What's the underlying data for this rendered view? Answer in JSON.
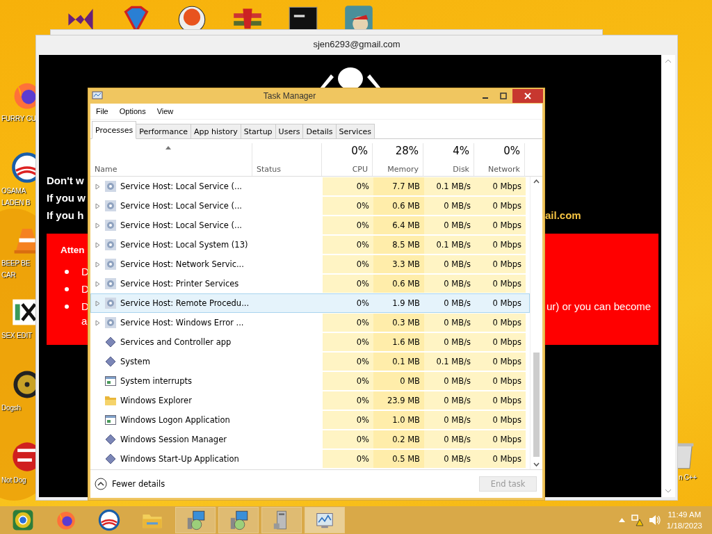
{
  "desktop": {
    "top_icons": [
      {
        "kind": "bowtie"
      },
      {
        "kind": "diamond"
      },
      {
        "kind": "ball"
      },
      {
        "kind": "emblem"
      },
      {
        "kind": "terminal"
      },
      {
        "kind": "globe"
      }
    ],
    "left_icons": [
      {
        "kind": "fox",
        "label": [
          "FURRY CU"
        ]
      },
      {
        "kind": "sunrise",
        "label": [
          "OSAMA",
          "LADEN B"
        ]
      },
      {
        "kind": "cone",
        "label": [
          "BEEP BE",
          "CAR"
        ]
      },
      {
        "kind": "hex",
        "label": [
          "SEX EDIT"
        ]
      },
      {
        "kind": "disc",
        "label": [
          "Dogsh"
        ]
      },
      {
        "kind": "dev",
        "label": [
          "Not Dog"
        ]
      }
    ],
    "right_icon": {
      "kind": "bin",
      "label": "n C++"
    }
  },
  "back_window": {
    "title": "sjen6293@gmail.com",
    "lines": [
      {
        "left": "Don't w"
      },
      {
        "left": "If you w"
      },
      {
        "left": "If you h",
        "right": "ail.com"
      }
    ],
    "notice": {
      "heading": "Atten",
      "bullets": [
        {
          "text": "D"
        },
        {
          "text": "D"
        },
        {
          "text": "D",
          "right": "ur) or you can become",
          "continuation": "a"
        }
      ]
    }
  },
  "task_manager": {
    "title": "Task Manager",
    "menu": [
      "File",
      "Options",
      "View"
    ],
    "tabs": [
      {
        "label": "Processes",
        "selected": true
      },
      {
        "label": "Performance",
        "selected": false
      },
      {
        "label": "App history",
        "selected": false
      },
      {
        "label": "Startup",
        "selected": false
      },
      {
        "label": "Users",
        "selected": false
      },
      {
        "label": "Details",
        "selected": false
      },
      {
        "label": "Services",
        "selected": false
      }
    ],
    "columns": [
      {
        "label": "Name"
      },
      {
        "label": "Status"
      },
      {
        "label": "CPU",
        "percent": "0%"
      },
      {
        "label": "Memory",
        "percent": "28%"
      },
      {
        "label": "Disk",
        "percent": "4%"
      },
      {
        "label": "Network",
        "percent": "0%"
      }
    ],
    "rows": [
      {
        "kind": "group",
        "name": "Service Host: Local Service (...",
        "cpu": "0%",
        "memory": "7.7 MB",
        "disk": "0.1 MB/s",
        "network": "0 Mbps",
        "selected": false
      },
      {
        "kind": "group",
        "name": "Service Host: Local Service (...",
        "cpu": "0%",
        "memory": "0.6 MB",
        "disk": "0 MB/s",
        "network": "0 Mbps",
        "selected": false
      },
      {
        "kind": "group",
        "name": "Service Host: Local Service (...",
        "cpu": "0%",
        "memory": "6.4 MB",
        "disk": "0 MB/s",
        "network": "0 Mbps",
        "selected": false
      },
      {
        "kind": "group",
        "name": "Service Host: Local System (13)",
        "cpu": "0%",
        "memory": "8.5 MB",
        "disk": "0.1 MB/s",
        "network": "0 Mbps",
        "selected": false
      },
      {
        "kind": "group",
        "name": "Service Host: Network Servic...",
        "cpu": "0%",
        "memory": "3.3 MB",
        "disk": "0 MB/s",
        "network": "0 Mbps",
        "selected": false
      },
      {
        "kind": "group",
        "name": "Service Host: Printer Services",
        "cpu": "0%",
        "memory": "0.6 MB",
        "disk": "0 MB/s",
        "network": "0 Mbps",
        "selected": false
      },
      {
        "kind": "group",
        "name": "Service Host: Remote Procedu...",
        "cpu": "0%",
        "memory": "1.9 MB",
        "disk": "0 MB/s",
        "network": "0 Mbps",
        "selected": true
      },
      {
        "kind": "group",
        "name": "Service Host: Windows Error ...",
        "cpu": "0%",
        "memory": "0.3 MB",
        "disk": "0 MB/s",
        "network": "0 Mbps",
        "selected": false
      },
      {
        "kind": "diamond",
        "name": "Services and Controller app",
        "cpu": "0%",
        "memory": "1.6 MB",
        "disk": "0 MB/s",
        "network": "0 Mbps",
        "selected": false
      },
      {
        "kind": "diamond",
        "name": "System",
        "cpu": "0%",
        "memory": "0.1 MB",
        "disk": "0.1 MB/s",
        "network": "0 Mbps",
        "selected": false
      },
      {
        "kind": "window",
        "name": "System interrupts",
        "cpu": "0%",
        "memory": "0 MB",
        "disk": "0 MB/s",
        "network": "0 Mbps",
        "selected": false
      },
      {
        "kind": "folder",
        "name": "Windows Explorer",
        "cpu": "0%",
        "memory": "23.9 MB",
        "disk": "0 MB/s",
        "network": "0 Mbps",
        "selected": false
      },
      {
        "kind": "window",
        "name": "Windows Logon Application",
        "cpu": "0%",
        "memory": "1.0 MB",
        "disk": "0 MB/s",
        "network": "0 Mbps",
        "selected": false
      },
      {
        "kind": "diamond",
        "name": "Windows Session Manager",
        "cpu": "0%",
        "memory": "0.2 MB",
        "disk": "0 MB/s",
        "network": "0 Mbps",
        "selected": false
      },
      {
        "kind": "diamond",
        "name": "Windows Start-Up Application",
        "cpu": "0%",
        "memory": "0.5 MB",
        "disk": "0 MB/s",
        "network": "0 Mbps",
        "selected": false
      }
    ],
    "footer": {
      "details": "Fewer details",
      "end_task": {
        "label": "End task",
        "disabled": true
      }
    }
  },
  "taskbar": {
    "apps": [
      {
        "kind": "chrome",
        "open": false,
        "active": false
      },
      {
        "kind": "fox",
        "open": false,
        "active": false
      },
      {
        "kind": "sunrise",
        "open": false,
        "active": false
      },
      {
        "kind": "folder",
        "open": false,
        "active": false
      },
      {
        "kind": "installer",
        "open": true,
        "active": false
      },
      {
        "kind": "installer",
        "open": true,
        "active": false
      },
      {
        "kind": "tower",
        "open": true,
        "active": false
      },
      {
        "kind": "monitor",
        "open": true,
        "active": true
      }
    ],
    "time": "11:49 AM",
    "date": "1/18/2023"
  }
}
